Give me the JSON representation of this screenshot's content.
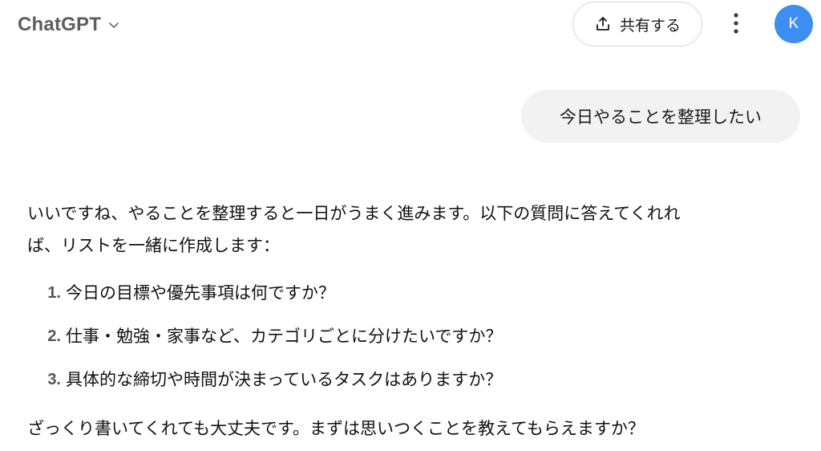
{
  "header": {
    "model_name": "ChatGPT",
    "model_switcher_icon": "chevron-down-icon",
    "share_label": "共有する",
    "share_icon": "share-upload-icon",
    "more_icon": "vertical-dots-icon",
    "avatar_initial": "K",
    "avatar_color": "#3d8ef0"
  },
  "conversation": {
    "user_message": "今日やることを整理したい",
    "assistant": {
      "intro_line1": "いいですね、やることを整理すると一日がうまく進みます。以下の質問に答えてくれれ",
      "intro_line2": "ば、リストを一緒に作成します：",
      "questions": [
        {
          "number": "1.",
          "text": "今日の目標や優先事項は何ですか？"
        },
        {
          "number": "2.",
          "text": "仕事・勉強・家事など、カテゴリごとに分けたいですか？"
        },
        {
          "number": "3.",
          "text": "具体的な締切や時間が決まっているタスクはありますか？"
        }
      ],
      "outro": "ざっくり書いてくれても大丈夫です。まずは思いつくことを教えてもらえますか？"
    }
  }
}
